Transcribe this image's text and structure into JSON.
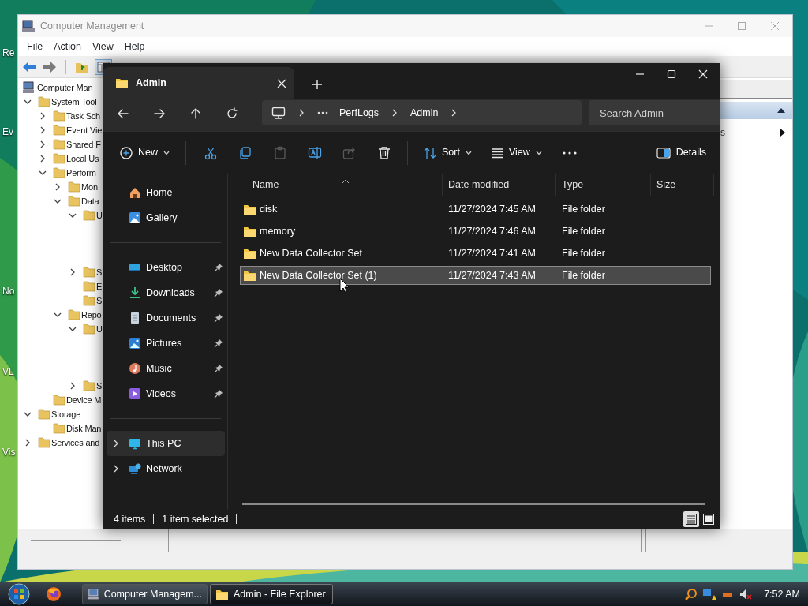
{
  "desktop_icons": [
    {
      "label": "Re"
    },
    {
      "label": "Ev"
    },
    {
      "label": "No"
    },
    {
      "label": "VL"
    },
    {
      "label": "Vis"
    }
  ],
  "mmc": {
    "title": "Computer Management",
    "menu": [
      "File",
      "Action",
      "View",
      "Help"
    ],
    "tree": [
      {
        "label": "Computer Man",
        "children": [
          {
            "label": "System Tool",
            "expandable": true,
            "expanded": true,
            "children": [
              {
                "label": "Task Sch",
                "expandable": true,
                "expanded": false
              },
              {
                "label": "Event Vie",
                "expandable": true,
                "expanded": false
              },
              {
                "label": "Shared F",
                "expandable": true,
                "expanded": false
              },
              {
                "label": "Local Us",
                "expandable": true,
                "expanded": false
              },
              {
                "label": "Perform",
                "expandable": true,
                "expanded": true,
                "children": [
                  {
                    "label": "Mon",
                    "expandable": true,
                    "expanded": false
                  },
                  {
                    "label": "Data",
                    "expandable": true,
                    "expanded": true,
                    "children": [
                      {
                        "label": "U",
                        "expandable": true,
                        "expanded": true
                      },
                      {
                        "label": "S",
                        "expandable": true,
                        "expanded": false
                      },
                      {
                        "label": "E",
                        "expandable": false
                      },
                      {
                        "label": "S",
                        "expandable": false
                      }
                    ]
                  },
                  {
                    "label": "Repo",
                    "expandable": true,
                    "expanded": true,
                    "children": [
                      {
                        "label": "U",
                        "expandable": true,
                        "expanded": true
                      },
                      {
                        "label": "S",
                        "expandable": true,
                        "expanded": false
                      }
                    ]
                  }
                ]
              },
              {
                "label": "Device M",
                "expandable": false
              }
            ]
          },
          {
            "label": "Storage",
            "expandable": true,
            "expanded": true,
            "children": [
              {
                "label": "Disk Man",
                "expandable": false
              }
            ]
          },
          {
            "label": "Services and",
            "expandable": true,
            "expanded": false
          }
        ]
      }
    ],
    "actions": {
      "item": "s"
    }
  },
  "explorer": {
    "tabs": [
      {
        "title": "Admin",
        "selected": true
      }
    ],
    "breadcrumb": [
      "PerfLogs",
      "Admin"
    ],
    "search": {
      "placeholder": "Search Admin"
    },
    "toolbar": [
      {
        "kind": "dropdown",
        "label": "New"
      },
      {
        "kind": "icon",
        "disabled": false
      },
      {
        "kind": "icon",
        "disabled": false
      },
      {
        "kind": "icon",
        "disabled": true
      },
      {
        "kind": "icon",
        "disabled": false
      },
      {
        "kind": "icon",
        "disabled": true
      },
      {
        "kind": "icon",
        "disabled": false
      },
      {
        "kind": "dropdown",
        "label": "Sort"
      },
      {
        "kind": "dropdown",
        "label": "View"
      },
      {
        "kind": "more"
      }
    ],
    "details_label": "Details",
    "sidebar": [
      {
        "items": [
          {
            "label": "Home",
            "pinned": false,
            "expandable": false,
            "selected": false
          },
          {
            "label": "Gallery",
            "pinned": false,
            "expandable": false,
            "selected": false
          }
        ]
      },
      {
        "items": [
          {
            "label": "Desktop",
            "pinned": true,
            "expandable": false,
            "selected": false
          },
          {
            "label": "Downloads",
            "pinned": true,
            "expandable": false,
            "selected": false
          },
          {
            "label": "Documents",
            "pinned": true,
            "expandable": false,
            "selected": false
          },
          {
            "label": "Pictures",
            "pinned": true,
            "expandable": false,
            "selected": false
          },
          {
            "label": "Music",
            "pinned": true,
            "expandable": false,
            "selected": false
          },
          {
            "label": "Videos",
            "pinned": true,
            "expandable": false,
            "selected": false
          }
        ]
      },
      {
        "items": [
          {
            "label": "This PC",
            "pinned": false,
            "expandable": true,
            "selected": true
          },
          {
            "label": "Network",
            "pinned": false,
            "expandable": true,
            "selected": false
          }
        ]
      }
    ],
    "columns": [
      {
        "label": "Name",
        "sorted": true
      },
      {
        "label": "Date modified",
        "sorted": false
      },
      {
        "label": "Type",
        "sorted": false
      },
      {
        "label": "Size",
        "sorted": false
      }
    ],
    "files": [
      {
        "name": "disk",
        "date": "11/27/2024 7:45 AM",
        "type": "File folder",
        "selected": false
      },
      {
        "name": "memory",
        "date": "11/27/2024 7:46 AM",
        "type": "File folder",
        "selected": false
      },
      {
        "name": "New Data Collector Set",
        "date": "11/27/2024 7:41 AM",
        "type": "File folder",
        "selected": false
      },
      {
        "name": "New Data Collector Set (1)",
        "date": "11/27/2024 7:43 AM",
        "type": "File folder",
        "selected": true
      }
    ],
    "status": {
      "count": "4 items",
      "selection": "1 item selected"
    },
    "view_buttons": [
      {
        "selected": true
      },
      {
        "selected": false
      }
    ]
  },
  "taskbar": {
    "buttons": [
      {
        "label": "Computer Managem...",
        "selected": false
      },
      {
        "label": "Admin - File Explorer",
        "selected": true
      }
    ],
    "clock": "7:52 AM"
  }
}
